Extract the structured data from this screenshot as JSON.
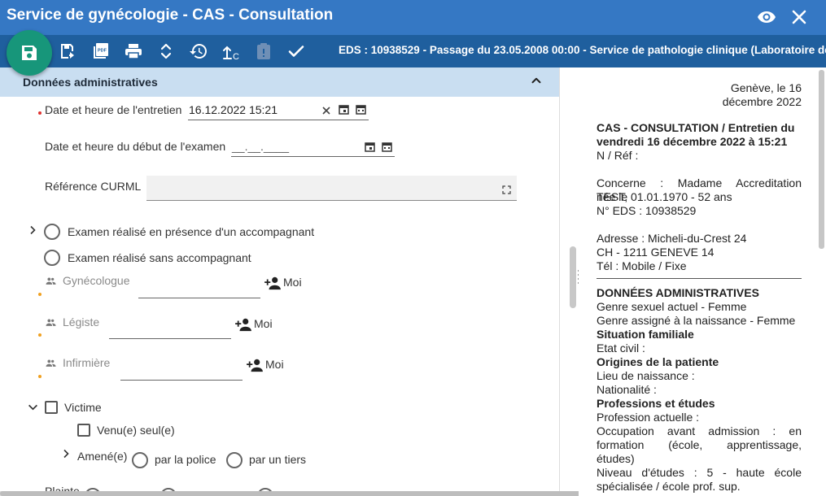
{
  "window": {
    "title": "Service de gynécologie - CAS - Consultation",
    "icons": [
      "eye-icon",
      "close-icon"
    ]
  },
  "toolbar": {
    "eds_info": "EDS : 10938529 - Passage du 23.05.2008 00:00 - Service de pathologie clinique (Laboratoire de",
    "tools": [
      "save-icon",
      "save-as-icon",
      "pdf-icon",
      "print-icon",
      "expand-collapse-icon",
      "history-icon",
      "upload-icon",
      "clipboard-icon",
      "validate-check-icon"
    ],
    "pdf_text": "PDF",
    "upload_suffix": "C"
  },
  "section": {
    "title": "Données administratives",
    "interview_label": "Date et heure de l'entretien",
    "interview_value": "16.12.2022 15:21",
    "exam_label": "Date et heure du début de l'examen",
    "exam_placeholder": "__.__.____",
    "curml_label": "Référence CURML",
    "curml_value": "",
    "radio_accompanied": "Examen réalisé en présence d'un accompagnant",
    "radio_alone": "Examen réalisé sans accompagnant",
    "gyneco_label": "Gynécologue",
    "legiste_label": "Légiste",
    "nurse_label": "Infirmière",
    "me_label": "Moi",
    "victim_label": "Victime",
    "came_alone": "Venu(e) seul(e)",
    "brought_label": "Amené(e)",
    "by_police": "par la police",
    "by_third": "par un tiers",
    "complaint_label": "Plainte"
  },
  "report": {
    "place_date_1": "Genève, le 16",
    "place_date_2": "décembre 2022",
    "heading_1": "CAS - CONSULTATION / Entretien du",
    "heading_2": "vendredi 16 décembre 2022 à 15:21",
    "ref": "N / Réf :",
    "concerne_1": "Concerne : Madame Accreditation TEST,",
    "concerne_2": "née le 01.01.1970 - 52 ans",
    "eds": "N° EDS : 10938529",
    "addr_1": "Adresse : Micheli-du-Crest 24",
    "addr_2": "CH - 1211 GENEVE 14",
    "tel": "Tél : Mobile / Fixe",
    "admin_title": "DONNÉES ADMINISTRATIVES",
    "genre_actuel": "Genre sexuel actuel - Femme",
    "genre_assigne": "Genre assigné à la naissance - Femme",
    "sit_fam": "Situation familiale",
    "etat_civil": "Etat civil :",
    "origines": "Origines de la patiente",
    "lieu_naissance": "Lieu de naissance :",
    "nationalite": "Nationalité :",
    "professions": "Professions et études",
    "profession_actuelle": "Profession actuelle :",
    "occupation_1": "Occupation avant admission : en",
    "occupation_2": "formation (école, apprentissage,",
    "occupation_3": "études)",
    "niveau_1": "Niveau d'études : 5 - haute école",
    "niveau_2": "spécialisée / école prof. sup."
  },
  "colors": {
    "titlebar": "#3578c4",
    "toolbar": "#1f5f9e",
    "save_fab": "#17967a",
    "section_header": "#c9def1",
    "required_dot": "#e0312f",
    "optional_dot": "#f0a020"
  }
}
